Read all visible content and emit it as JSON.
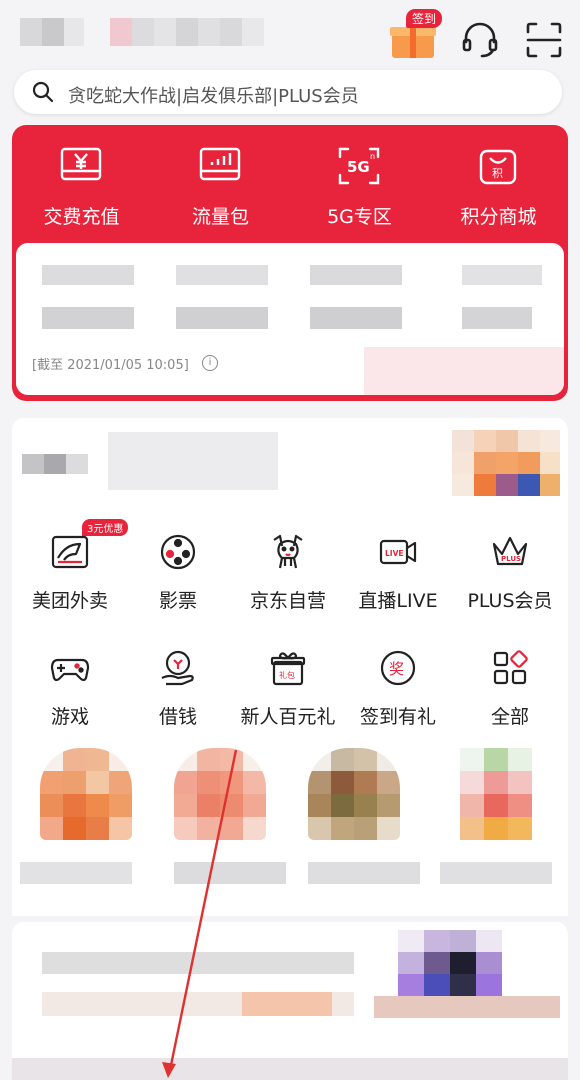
{
  "header": {
    "signin_badge": "签到",
    "icons": [
      "gift-icon",
      "headset-icon",
      "scan-icon"
    ]
  },
  "search": {
    "placeholder": "贪吃蛇大作战|启发俱乐部|PLUS会员"
  },
  "quick_actions": [
    {
      "label": "交费充值",
      "icon": "yen-card-icon"
    },
    {
      "label": "流量包",
      "icon": "data-chart-icon"
    },
    {
      "label": "5G专区",
      "icon": "5g-icon"
    },
    {
      "label": "积分商城",
      "icon": "points-bag-icon"
    }
  ],
  "balance_card": {
    "deadline": "[截至 2021/01/05 10:05]",
    "info_icon": "ⓘ"
  },
  "services": [
    {
      "label": "美团外卖",
      "icon": "meituan-icon",
      "badge": "3元优惠"
    },
    {
      "label": "影票",
      "icon": "film-reel-icon"
    },
    {
      "label": "京东自营",
      "icon": "jd-dog-icon"
    },
    {
      "label": "直播LIVE",
      "icon": "live-camera-icon"
    },
    {
      "label": "PLUS会员",
      "icon": "plus-crown-icon"
    },
    {
      "label": "游戏",
      "icon": "gamepad-icon"
    },
    {
      "label": "借钱",
      "icon": "money-hand-icon"
    },
    {
      "label": "新人百元礼",
      "icon": "gift-box-icon"
    },
    {
      "label": "签到有礼",
      "icon": "reward-medal-icon"
    },
    {
      "label": "全部",
      "icon": "all-grid-icon"
    }
  ],
  "colors": {
    "brand_red": "#e8243c",
    "background": "#f4f4f6"
  }
}
